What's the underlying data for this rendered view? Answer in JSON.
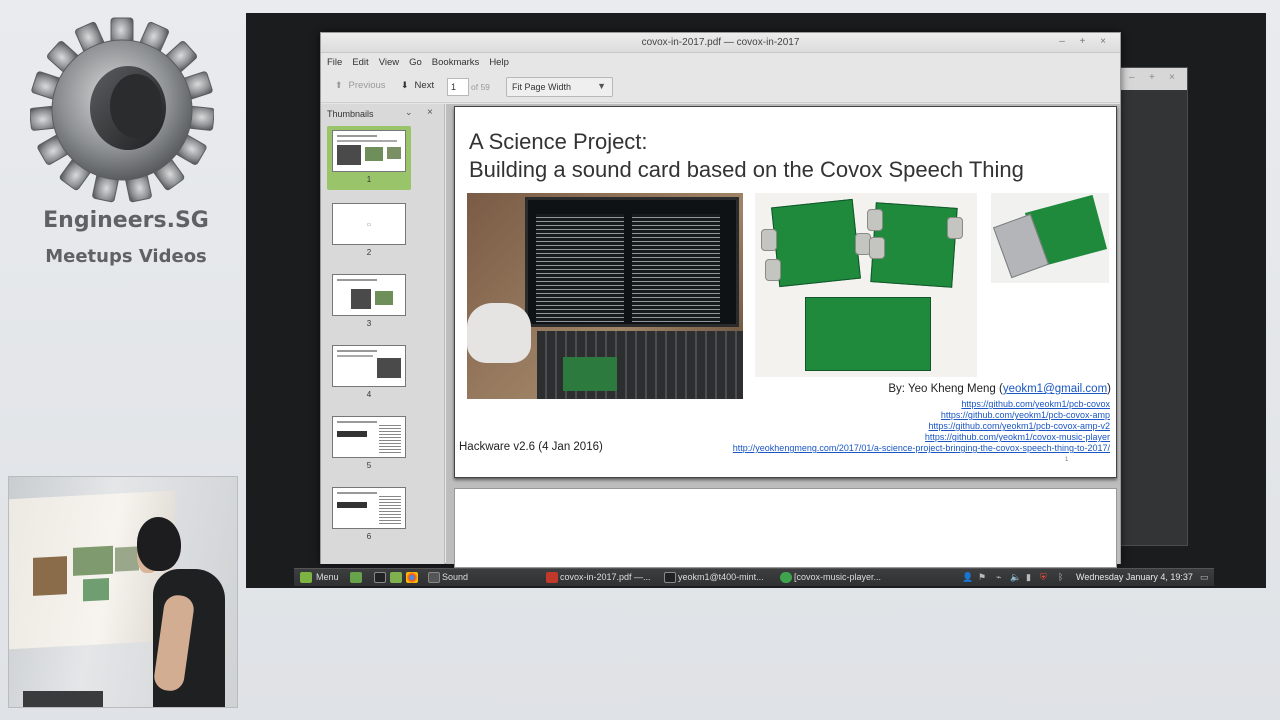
{
  "branding": {
    "title": "Engineers.SG",
    "subtitle": "Meetups Videos"
  },
  "window": {
    "title": "covox-in-2017.pdf — covox-in-2017",
    "controls": "– + ×"
  },
  "menu": [
    "File",
    "Edit",
    "View",
    "Go",
    "Bookmarks",
    "Help"
  ],
  "toolbar": {
    "previous_label": "Previous",
    "next_label": "Next",
    "page_value": "1",
    "page_of": "of 59",
    "zoom_value": "Fit Page Width"
  },
  "sidebar": {
    "header": "Thumbnails",
    "thumbnails": [
      {
        "label": "1",
        "selected": true
      },
      {
        "label": "2",
        "selected": false
      },
      {
        "label": "3",
        "selected": false
      },
      {
        "label": "4",
        "selected": false
      },
      {
        "label": "5",
        "selected": false
      },
      {
        "label": "6",
        "selected": false
      }
    ]
  },
  "slide": {
    "title_line1": "A Science Project:",
    "title_line2": "Building a sound card based on the Covox Speech Thing",
    "byline_prefix": "By: Yeo Kheng Meng (",
    "byline_email": "yeokm1@gmail.com",
    "byline_suffix": ")",
    "links": [
      "https://github.com/yeokm1/pcb-covox",
      "https://github.com/yeokm1/pcb-covox-amp",
      "https://github.com/yeokm1/pcb-covox-amp-v2",
      "https://github.com/yeokm1/covox-music-player",
      "http://yeokhengmeng.com/2017/01/a-science-project-bringing-the-covox-speech-thing-to-2017/"
    ],
    "footer": "Hackware v2.6 (4 Jan 2016)",
    "page_number": "1"
  },
  "taskbar": {
    "menu_label": "Menu",
    "sound_label": "Sound",
    "tasks": [
      "covox-in-2017.pdf —...",
      "yeokm1@t400-mint...",
      "[covox-music-player..."
    ],
    "clock": "Wednesday January  4, 19:37"
  },
  "colors": {
    "accent_green": "#99c46a",
    "link_blue": "#1a56c4"
  }
}
